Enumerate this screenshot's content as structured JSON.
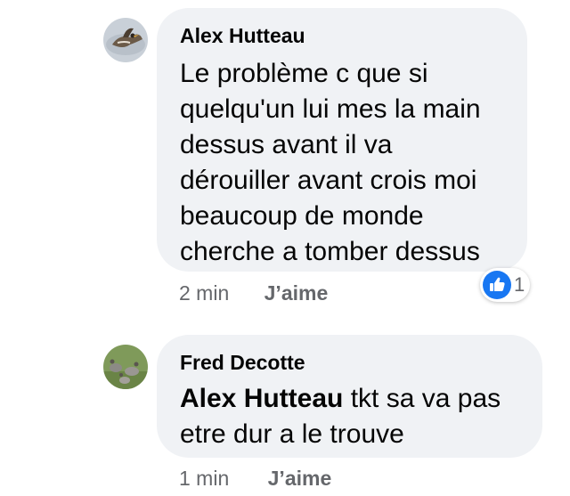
{
  "comments": [
    {
      "author": "Alex Hutteau",
      "text_lines": [
        "Le problème c que si",
        "quelqu'un lui mes la main",
        "dessus avant il va",
        "dérouiller avant crois moi",
        "beaucoup de monde",
        "cherche a tomber dessus"
      ],
      "time": "2 min",
      "like_label": "J’aime",
      "reaction_count": "1"
    },
    {
      "author": "Fred Decotte",
      "mention": "Alex Hutteau",
      "text_after_mention": " tkt sa va pas",
      "text_line_2": "etre dur a le trouve",
      "time": "1 min",
      "like_label": "J’aime"
    }
  ],
  "colors": {
    "bubble_bg": "#f0f2f5",
    "meta_text": "#65676b",
    "like_blue": "#1877f2"
  },
  "icons": {
    "reaction": "thumbs-up-icon"
  }
}
